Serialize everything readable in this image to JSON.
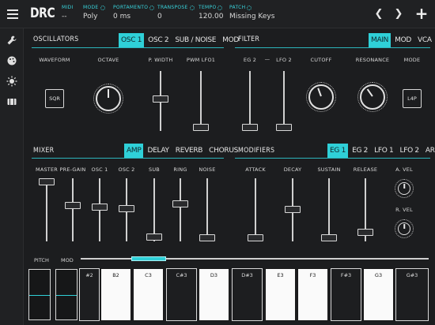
{
  "app": {
    "logo": "DRC"
  },
  "header": {
    "params": [
      {
        "label": "MIDI",
        "value": "--",
        "has_settings": false
      },
      {
        "label": "MODE",
        "value": "Poly",
        "has_settings": true
      },
      {
        "label": "PORTAMENTO",
        "value": "0 ms",
        "has_settings": true
      },
      {
        "label": "TRANSPOSE",
        "value": "0",
        "has_settings": true
      },
      {
        "label": "TEMPO",
        "value": "120.00",
        "has_settings": true
      },
      {
        "label": "PATCH",
        "value": "Missing Keys",
        "has_settings": true
      }
    ],
    "prev_icon": "chevron-left-icon",
    "next_icon": "chevron-right-icon",
    "add_icon": "plus-icon"
  },
  "rail": {
    "icons": [
      "wrench-icon",
      "palette-icon",
      "brightness-icon",
      "film-icon"
    ]
  },
  "oscillators": {
    "title": "OSCILLATORS",
    "tabs": [
      "OSC 1",
      "OSC 2",
      "SUB / NOISE",
      "MOD"
    ],
    "active_tab": "OSC 1",
    "labels": {
      "waveform": "WAVEFORM",
      "octave": "OCTAVE",
      "p_width": "P. WIDTH",
      "pwm_lfo1": "PWM LFO1"
    },
    "waveform_value": "SQR"
  },
  "filter": {
    "title": "FILTER",
    "tabs": [
      "MAIN",
      "MOD",
      "VCA"
    ],
    "active_tab": "MAIN",
    "labels": {
      "eg2": "EG 2",
      "dash": "—",
      "lfo2": "LFO 2",
      "cutoff": "CUTOFF",
      "resonance": "RESONANCE",
      "mode": "MODE"
    },
    "mode_value": "L4P"
  },
  "mixer": {
    "title": "MIXER",
    "tabs": [
      "AMP",
      "DELAY",
      "REVERB",
      "CHORUS"
    ],
    "active_tab": "AMP",
    "labels": [
      "MASTER",
      "PRE-GAIN",
      "OSC 1",
      "OSC 2",
      "SUB",
      "RING",
      "NOISE"
    ]
  },
  "modifiers": {
    "title": "MODIFIERS",
    "tabs": [
      "EG 1",
      "EG 2",
      "LFO 1",
      "LFO 2",
      "ARP"
    ],
    "active_tab": "EG 1",
    "labels": [
      "ATTACK",
      "DECAY",
      "SUSTAIN",
      "RELEASE"
    ],
    "vel_labels": {
      "a_vel": "A. VEL",
      "r_vel": "R. VEL"
    }
  },
  "keyboard": {
    "pitch_label": "PITCH",
    "mod_label": "MOD",
    "keys": [
      {
        "label": "#2",
        "color": "black"
      },
      {
        "label": "B2",
        "color": "white"
      },
      {
        "label": "C3",
        "color": "white"
      },
      {
        "label": "C#3",
        "color": "black"
      },
      {
        "label": "D3",
        "color": "white"
      },
      {
        "label": "D#3",
        "color": "black"
      },
      {
        "label": "E3",
        "color": "white"
      },
      {
        "label": "F3",
        "color": "white"
      },
      {
        "label": "F#3",
        "color": "black"
      },
      {
        "label": "G3",
        "color": "white"
      },
      {
        "label": "G#3",
        "color": "black"
      }
    ]
  },
  "colors": {
    "accent": "#2fd0d8",
    "background": "#1c1d1f",
    "text": "#e6e6e6"
  }
}
